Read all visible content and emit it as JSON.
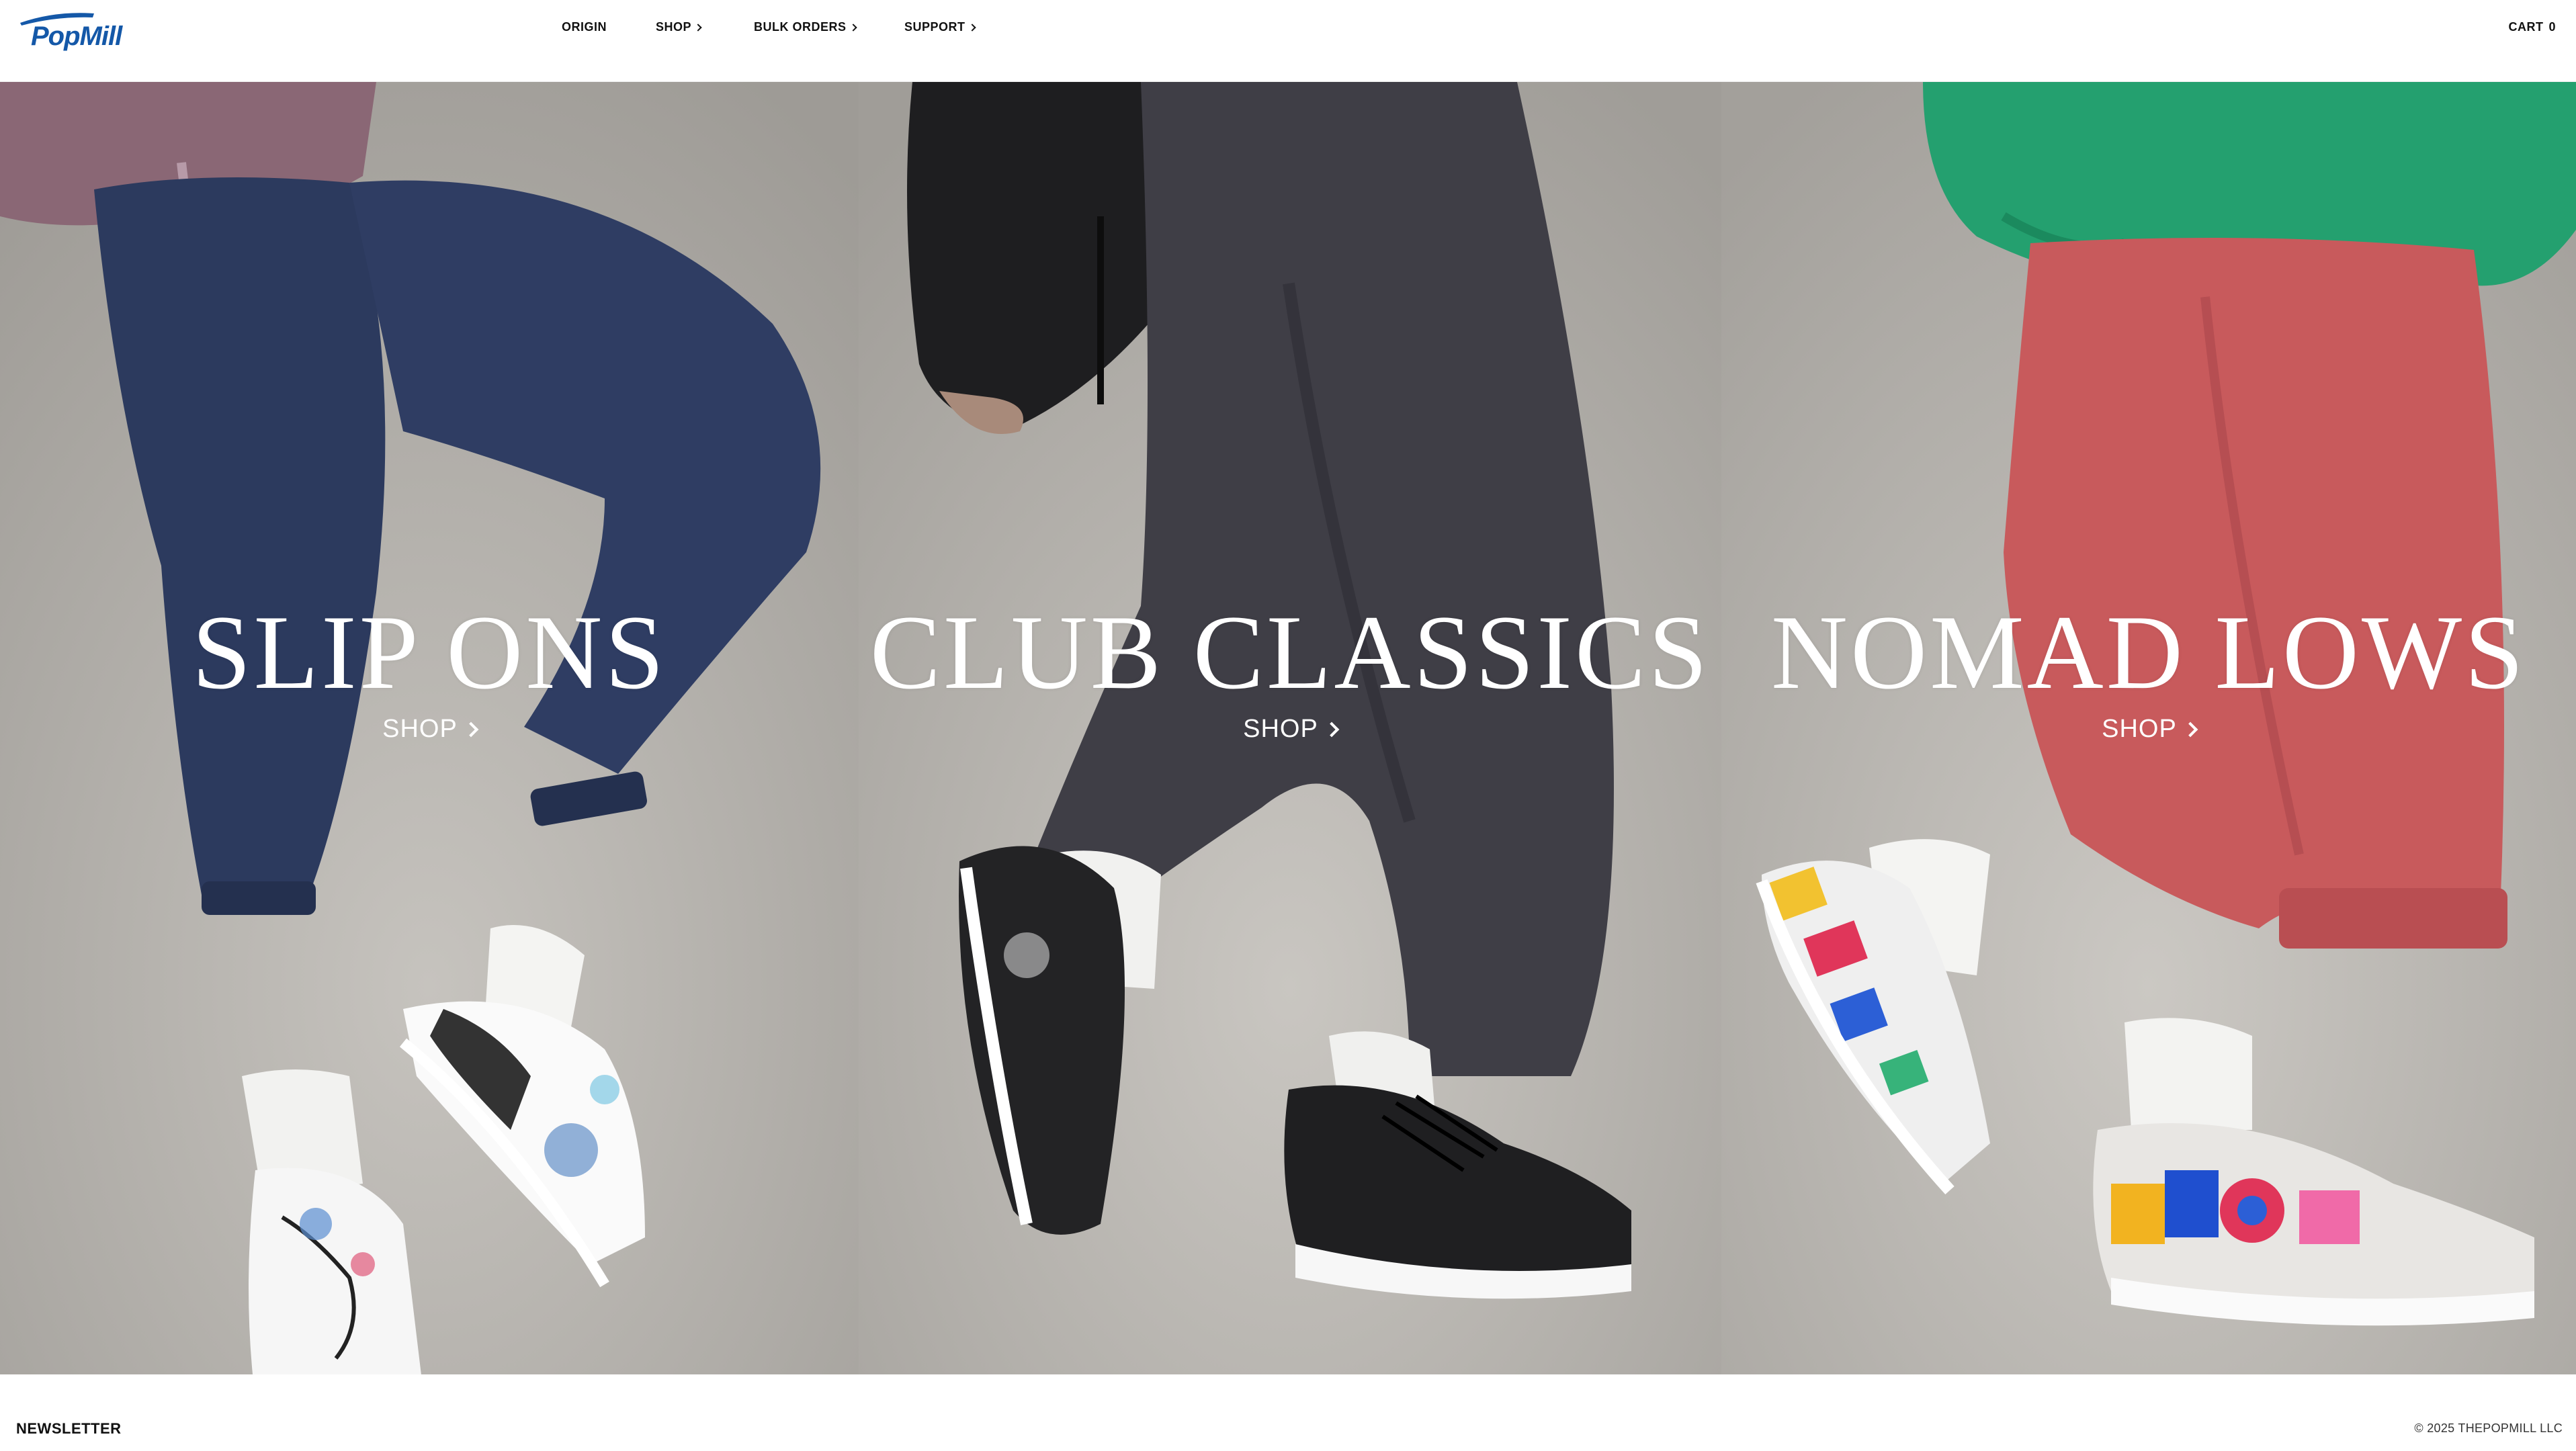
{
  "brand": {
    "logo_text": "PopMill",
    "color": "#1458a8"
  },
  "nav": {
    "items": [
      {
        "label": "ORIGIN",
        "has_dropdown": false
      },
      {
        "label": "SHOP",
        "has_dropdown": true
      },
      {
        "label": "BULK ORDERS",
        "has_dropdown": true
      },
      {
        "label": "SUPPORT",
        "has_dropdown": true
      }
    ],
    "cart_label": "CART",
    "cart_count": "0"
  },
  "panels": [
    {
      "title": "SLIP ONS",
      "cta": "SHOP",
      "pants_color": "#2c3a5e",
      "shoe_style": "white slip-on with hand-painted giraffe and fish art"
    },
    {
      "title": "CLUB CLASSICS",
      "cta": "SHOP",
      "pants_color": "#3f3e46",
      "shoe_style": "black leather low-top sneakers"
    },
    {
      "title": "NOMAD LOWS",
      "cta": "SHOP",
      "pants_color": "#c85a5c",
      "shoe_style": "colorful graphic low-top sneakers"
    }
  ],
  "footer": {
    "newsletter_label": "NEWSLETTER",
    "copyright": "© 2025 THEPOPMILL LLC"
  }
}
